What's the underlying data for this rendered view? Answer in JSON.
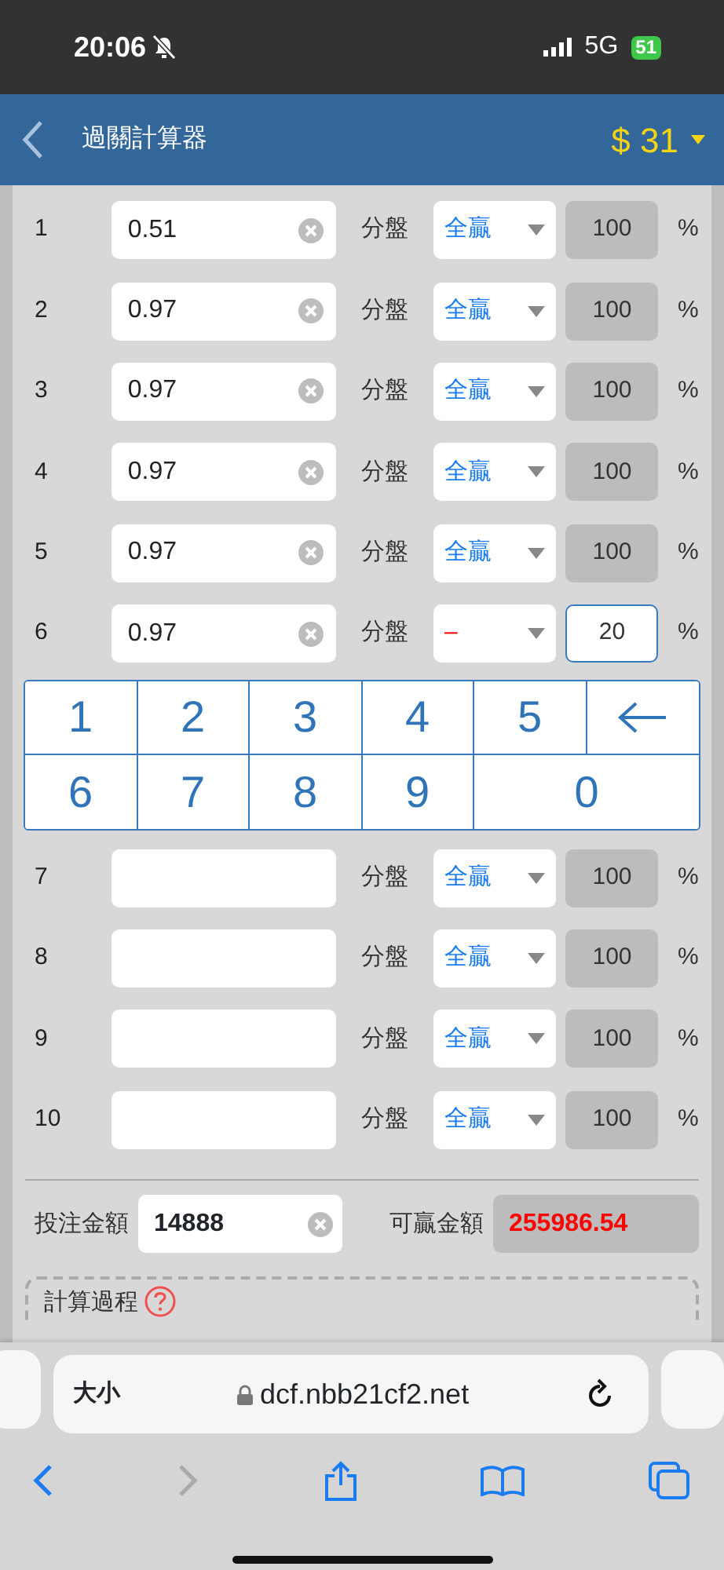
{
  "status_bar": {
    "time": "20:06",
    "network": "5G",
    "battery": "51"
  },
  "header": {
    "title": "過關計算器",
    "balance": "$ 31"
  },
  "legs": [
    {
      "number": "1",
      "odds": "0.51",
      "type": "分盤",
      "result": "全贏",
      "color": "#1a7cf0",
      "percent": "100",
      "editing": false,
      "unit": "%"
    },
    {
      "number": "2",
      "odds": "0.97",
      "type": "分盤",
      "result": "全贏",
      "color": "#1a7cf0",
      "percent": "100",
      "editing": false,
      "unit": "%"
    },
    {
      "number": "3",
      "odds": "0.97",
      "type": "分盤",
      "result": "全贏",
      "color": "#1a7cf0",
      "percent": "100",
      "editing": false,
      "unit": "%"
    },
    {
      "number": "4",
      "odds": "0.97",
      "type": "分盤",
      "result": "全贏",
      "color": "#1a7cf0",
      "percent": "100",
      "editing": false,
      "unit": "%"
    },
    {
      "number": "5",
      "odds": "0.97",
      "type": "分盤",
      "result": "全贏",
      "color": "#1a7cf0",
      "percent": "100",
      "editing": false,
      "unit": "%"
    },
    {
      "number": "6",
      "odds": "0.97",
      "type": "分盤",
      "result": "–",
      "color": "#ff0000",
      "percent": "20",
      "editing": true,
      "unit": "%"
    }
  ],
  "keypad": [
    {
      "kind": "digit",
      "label": "1"
    },
    {
      "kind": "digit",
      "label": "2"
    },
    {
      "kind": "digit",
      "label": "3"
    },
    {
      "kind": "digit",
      "label": "4"
    },
    {
      "kind": "digit",
      "label": "5"
    },
    {
      "kind": "backspace"
    },
    {
      "kind": "digit",
      "label": "6"
    },
    {
      "kind": "digit",
      "label": "7"
    },
    {
      "kind": "digit",
      "label": "8"
    },
    {
      "kind": "digit",
      "label": "9"
    },
    {
      "kind": "digit",
      "label": "0"
    }
  ],
  "legs_below_keypad": [
    {
      "number": "7",
      "type": "分盤",
      "result": "全贏",
      "color": "#1a7cf0",
      "percent": "100",
      "editing": false,
      "unit": "%"
    },
    {
      "number": "8",
      "type": "分盤",
      "result": "全贏",
      "color": "#1a7cf0",
      "percent": "100",
      "editing": false,
      "unit": "%"
    },
    {
      "number": "9",
      "type": "分盤",
      "result": "全贏",
      "color": "#1a7cf0",
      "percent": "100",
      "editing": false,
      "unit": "%"
    },
    {
      "number": "10",
      "type": "分盤",
      "result": "全贏",
      "color": "#1a7cf0",
      "percent": "100",
      "editing": false,
      "unit": "%"
    }
  ],
  "stake": {
    "label": "投注金額",
    "value": "14888"
  },
  "payout": {
    "label": "可贏金額",
    "value": "255986.54"
  },
  "process": {
    "title": "計算過程"
  },
  "browser": {
    "text_size": "大小",
    "url": "dcf.nbb21cf2.net"
  }
}
